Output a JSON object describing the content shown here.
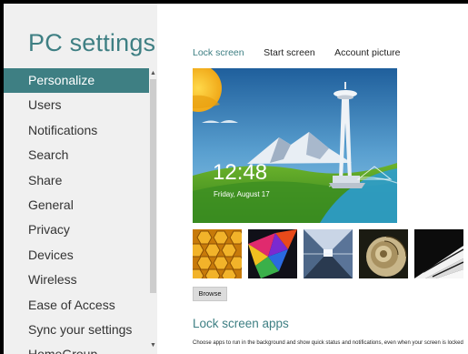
{
  "left": {
    "title": "PC settings",
    "items": [
      {
        "label": "Personalize",
        "selected": true
      },
      {
        "label": "Users"
      },
      {
        "label": "Notifications"
      },
      {
        "label": "Search"
      },
      {
        "label": "Share"
      },
      {
        "label": "General"
      },
      {
        "label": "Privacy"
      },
      {
        "label": "Devices"
      },
      {
        "label": "Wireless"
      },
      {
        "label": "Ease of Access"
      },
      {
        "label": "Sync your settings"
      },
      {
        "label": "HomeGroup"
      }
    ]
  },
  "right": {
    "tabs": [
      {
        "label": "Lock screen",
        "active": true
      },
      {
        "label": "Start screen"
      },
      {
        "label": "Account picture"
      }
    ],
    "preview": {
      "time": "12:48",
      "date": "Friday, August 17"
    },
    "thumbnails": [
      {
        "name": "honeycomb-image"
      },
      {
        "name": "prism-image"
      },
      {
        "name": "tunnel-image"
      },
      {
        "name": "nautilus-shell-image"
      },
      {
        "name": "piano-keys-image"
      }
    ],
    "browse_label": "Browse",
    "lock_screen_apps": {
      "title": "Lock screen apps",
      "description": "Choose apps to run in the background and show quick status and notifications, even when your screen is locked"
    }
  },
  "colors": {
    "accent": "#3e7f83",
    "nav_background": "#f0f0f0"
  }
}
